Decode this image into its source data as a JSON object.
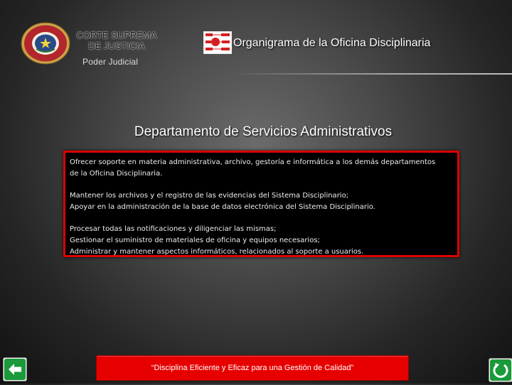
{
  "header": {
    "court_line1": "CORTE SUPREMA",
    "court_line2": "DE JUSTICIA",
    "subtitle": "Poder Judicial",
    "title": "Organigrama  de la Oficina Disciplinaria",
    "seal_text": "REPUBLICA DEL PARAGUAY"
  },
  "department": {
    "title": "Departamento de Servicios Administrativos"
  },
  "content": {
    "p1_line1": "Ofrecer soporte en materia administrativa, archivo, gestoría e informática a los demás departamentos",
    "p1_line2": "de la Oficina Disciplinaria.",
    "p2_line1": "Mantener los archivos y el registro de las evidencias del Sistema Disciplinario;",
    "p2_line2": "Apoyar en la administración de la base de datos electrónica del Sistema Disciplinario.",
    "p3_line1": "Procesar todas las notificaciones y diligenciar las mismas;",
    "p3_line2": "Gestionar el suministro de materiales de oficina y equipos necesarios;",
    "p3_line3": "Administrar y mantener aspectos informáticos, relacionados al soporte a usuarios."
  },
  "footer": {
    "slogan": "“Disciplina Eficiente y Eficaz para una Gestión de Calidad”"
  },
  "colors": {
    "accent_red": "#e60000",
    "box_border": "#dd0000",
    "nav_icon_green": "#1a9a3a"
  },
  "icons": {
    "back": "arrow-left-icon",
    "return": "return-arrow-icon",
    "org": "org-chart-icon",
    "seal": "national-seal-icon"
  }
}
